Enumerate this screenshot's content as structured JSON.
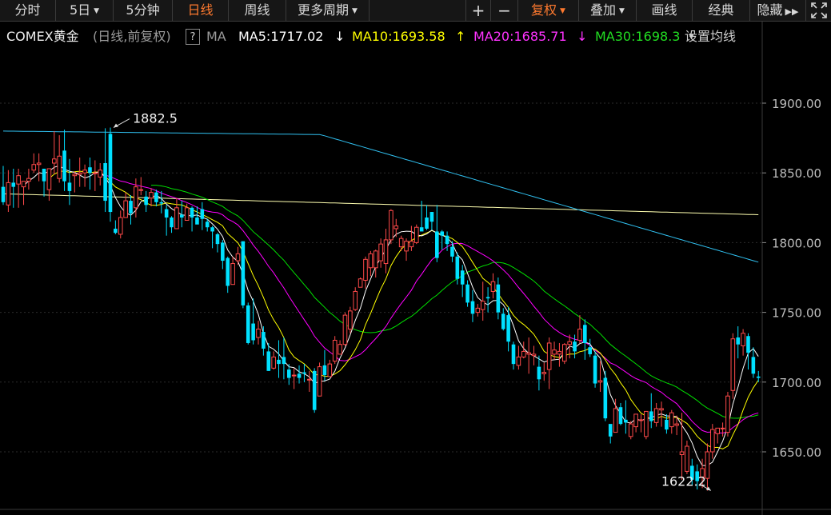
{
  "toolbar": {
    "tabs": [
      {
        "label": "分时",
        "active": false,
        "dropdown": false
      },
      {
        "label": "5日",
        "active": false,
        "dropdown": true
      },
      {
        "label": "5分钟",
        "active": false,
        "dropdown": false
      },
      {
        "label": "日线",
        "active": true,
        "dropdown": false
      },
      {
        "label": "周线",
        "active": false,
        "dropdown": false
      },
      {
        "label": "更多周期",
        "active": false,
        "dropdown": true
      }
    ],
    "tools": [
      {
        "label": "+",
        "active": false,
        "dropdown": false
      },
      {
        "label": "−",
        "active": false,
        "dropdown": false
      },
      {
        "label": "复权",
        "active": true,
        "dropdown": true
      },
      {
        "label": "叠加",
        "active": false,
        "dropdown": true
      },
      {
        "label": "画线",
        "active": false,
        "dropdown": false
      },
      {
        "label": "经典",
        "active": false,
        "dropdown": false
      },
      {
        "label": "隐藏",
        "active": false,
        "dropdown": false,
        "icon": "double-chevron-right-icon"
      }
    ],
    "fullscreen_icon": "fullscreen-icon"
  },
  "info": {
    "symbol": "COMEX黄金",
    "mode": "(日线,前复权)",
    "help": "?",
    "ma_label": "MA",
    "ma5": "MA5:1717.02",
    "ma5_arrow": "↓",
    "ma10": "MA10:1693.58",
    "ma10_arrow": "↑",
    "ma20": "MA20:1685.71",
    "ma20_arrow": "↓",
    "ma30": "MA30:1698.3",
    "ma_settings": "设置均线",
    "colors": {
      "ma5": "#ffffff",
      "ma10": "#ffff00",
      "ma20": "#ff00ff",
      "ma30": "#00e000"
    }
  },
  "chart_data": {
    "type": "candlestick",
    "yticks": [
      "1900.00",
      "1850.00",
      "1800.00",
      "1750.00",
      "1700.00",
      "1650.00"
    ],
    "ytick_values": [
      1900,
      1850,
      1800,
      1750,
      1700,
      1650
    ],
    "annotations": [
      {
        "text": "1882.5",
        "candle": 21,
        "value": 1882.5
      },
      {
        "text": "1622.2",
        "candle": 139,
        "value": 1622.2
      }
    ],
    "colors": {
      "up": "#ff4a4a",
      "down": "#00e0ff",
      "ma60": "#ffffb0",
      "ma120": "#30c0f0"
    },
    "candles": [
      [
        1840,
        1855,
        1829,
        1827
      ],
      [
        1827,
        1852,
        1843,
        1822
      ],
      [
        1843,
        1853,
        1840,
        1825
      ],
      [
        1842,
        1853,
        1848,
        1825
      ],
      [
        1840,
        1844,
        1844,
        1827
      ],
      [
        1844,
        1853,
        1846,
        1838
      ],
      [
        1852,
        1864,
        1856,
        1850
      ],
      [
        1856,
        1864,
        1857,
        1844
      ],
      [
        1853,
        1851,
        1844,
        1833
      ],
      [
        1838,
        1851,
        1853,
        1830
      ],
      [
        1857,
        1880,
        1860,
        1849
      ],
      [
        1846,
        1877,
        1862,
        1843
      ],
      [
        1866,
        1881,
        1844,
        1837
      ],
      [
        1843,
        1860,
        1837,
        1827
      ],
      [
        1848,
        1851,
        1849,
        1836
      ],
      [
        1849,
        1861,
        1850,
        1840
      ],
      [
        1850,
        1856,
        1852,
        1840
      ],
      [
        1854,
        1861,
        1850,
        1838
      ],
      [
        1850,
        1859,
        1850,
        1837
      ],
      [
        1847,
        1857,
        1852,
        1841
      ],
      [
        1857,
        1882,
        1830,
        1822
      ],
      [
        1878,
        1882.5,
        1822,
        1815
      ],
      [
        1810,
        1816,
        1807,
        1806
      ],
      [
        1806,
        1823,
        1818,
        1803
      ],
      [
        1818,
        1836,
        1830,
        1823
      ],
      [
        1830,
        1834,
        1821,
        1813
      ],
      [
        1825,
        1846,
        1840,
        1818
      ],
      [
        1838,
        1847,
        1838,
        1834
      ],
      [
        1833,
        1837,
        1827,
        1822
      ],
      [
        1832,
        1839,
        1836,
        1826
      ],
      [
        1836,
        1838,
        1829,
        1826
      ],
      [
        1829,
        1837,
        1828,
        1821
      ],
      [
        1824,
        1827,
        1818,
        1805
      ],
      [
        1818,
        1819,
        1811,
        1807
      ],
      [
        1810,
        1832,
        1825,
        1818
      ],
      [
        1820,
        1830,
        1818,
        1811
      ],
      [
        1816,
        1828,
        1825,
        1818
      ],
      [
        1825,
        1826,
        1818,
        1808
      ],
      [
        1818,
        1826,
        1813,
        1816
      ],
      [
        1824,
        1829,
        1817,
        1809
      ],
      [
        1815,
        1817,
        1811,
        1808
      ],
      [
        1811,
        1812,
        1808,
        1796
      ],
      [
        1806,
        1807,
        1799,
        1793
      ],
      [
        1800,
        1802,
        1787,
        1781
      ],
      [
        1789,
        1790,
        1769,
        1764
      ],
      [
        1770,
        1790,
        1785,
        1775
      ],
      [
        1787,
        1797,
        1792,
        1784
      ],
      [
        1801,
        1799,
        1755,
        1753
      ],
      [
        1755,
        1757,
        1728,
        1727
      ],
      [
        1742,
        1760,
        1730,
        1727
      ],
      [
        1732,
        1744,
        1738,
        1727
      ],
      [
        1736,
        1740,
        1724,
        1719
      ],
      [
        1722,
        1728,
        1708,
        1708
      ],
      [
        1710,
        1722,
        1718,
        1709
      ],
      [
        1716,
        1730,
        1713,
        1703
      ],
      [
        1718,
        1732,
        1713,
        1702
      ],
      [
        1709,
        1713,
        1703,
        1698
      ],
      [
        1705,
        1710,
        1705,
        1695
      ],
      [
        1706,
        1712,
        1703,
        1699
      ],
      [
        1707,
        1713,
        1706,
        1700
      ],
      [
        1702,
        1708,
        1702,
        1693
      ],
      [
        1708,
        1710,
        1680,
        1678
      ],
      [
        1690,
        1714,
        1711,
        1702
      ],
      [
        1712,
        1723,
        1705,
        1701
      ],
      [
        1704,
        1716,
        1713,
        1706
      ],
      [
        1715,
        1733,
        1730,
        1713
      ],
      [
        1720,
        1730,
        1727,
        1720
      ],
      [
        1727,
        1750,
        1748,
        1726
      ],
      [
        1738,
        1754,
        1751,
        1735
      ],
      [
        1752,
        1768,
        1765,
        1751
      ],
      [
        1768,
        1775,
        1774,
        1768
      ],
      [
        1773,
        1790,
        1788,
        1767
      ],
      [
        1782,
        1794,
        1792,
        1776
      ],
      [
        1782,
        1795,
        1794,
        1775
      ],
      [
        1787,
        1803,
        1799,
        1782
      ],
      [
        1785,
        1810,
        1802,
        1778
      ],
      [
        1802,
        1824,
        1823,
        1799
      ],
      [
        1810,
        1817,
        1812,
        1804
      ],
      [
        1797,
        1805,
        1803,
        1794
      ],
      [
        1794,
        1803,
        1801,
        1787
      ],
      [
        1797,
        1812,
        1801,
        1794
      ],
      [
        1800,
        1813,
        1811,
        1799
      ],
      [
        1811,
        1830,
        1808,
        1809
      ],
      [
        1818,
        1827,
        1810,
        1809
      ],
      [
        1822,
        1822,
        1815,
        1809
      ],
      [
        1808,
        1827,
        1789,
        1786
      ],
      [
        1808,
        1809,
        1805,
        1795
      ],
      [
        1805,
        1808,
        1799,
        1794
      ],
      [
        1797,
        1801,
        1790,
        1786
      ],
      [
        1790,
        1793,
        1774,
        1770
      ],
      [
        1780,
        1784,
        1770,
        1761
      ],
      [
        1770,
        1773,
        1757,
        1754
      ],
      [
        1758,
        1766,
        1749,
        1743
      ],
      [
        1750,
        1756,
        1753,
        1747
      ],
      [
        1752,
        1772,
        1758,
        1744
      ],
      [
        1761,
        1768,
        1760,
        1750
      ],
      [
        1765,
        1778,
        1772,
        1760
      ],
      [
        1770,
        1775,
        1750,
        1745
      ],
      [
        1749,
        1753,
        1738,
        1737
      ],
      [
        1748,
        1754,
        1729,
        1722
      ],
      [
        1727,
        1729,
        1713,
        1709
      ],
      [
        1712,
        1726,
        1718,
        1709
      ],
      [
        1718,
        1729,
        1722,
        1717
      ],
      [
        1720,
        1732,
        1721,
        1706
      ],
      [
        1719,
        1726,
        1720,
        1712
      ],
      [
        1711,
        1719,
        1702,
        1694
      ],
      [
        1706,
        1714,
        1707,
        1701
      ],
      [
        1709,
        1732,
        1728,
        1695
      ],
      [
        1720,
        1729,
        1723,
        1716
      ],
      [
        1720,
        1728,
        1722,
        1711
      ],
      [
        1715,
        1728,
        1727,
        1713
      ],
      [
        1727,
        1734,
        1729,
        1717
      ],
      [
        1729,
        1734,
        1722,
        1717
      ],
      [
        1730,
        1748,
        1738,
        1728
      ],
      [
        1741,
        1745,
        1728,
        1716
      ],
      [
        1725,
        1731,
        1720,
        1718
      ],
      [
        1719,
        1722,
        1699,
        1696
      ],
      [
        1700,
        1715,
        1701,
        1693
      ],
      [
        1703,
        1708,
        1674,
        1672
      ],
      [
        1670,
        1667,
        1661,
        1656
      ],
      [
        1664,
        1688,
        1681,
        1668
      ],
      [
        1682,
        1685,
        1670,
        1669
      ],
      [
        1673,
        1687,
        1671,
        1663
      ],
      [
        1661,
        1672,
        1670,
        1659
      ],
      [
        1668,
        1672,
        1677,
        1664
      ],
      [
        1673,
        1677,
        1673,
        1664
      ],
      [
        1661,
        1676,
        1679,
        1659
      ],
      [
        1679,
        1692,
        1672,
        1667
      ],
      [
        1671,
        1685,
        1681,
        1668
      ],
      [
        1680,
        1686,
        1681,
        1668
      ],
      [
        1673,
        1677,
        1666,
        1663
      ],
      [
        1668,
        1680,
        1678,
        1663
      ],
      [
        1669,
        1676,
        1670,
        1662
      ],
      [
        1648,
        1678,
        1650,
        1630
      ],
      [
        1636,
        1658,
        1654,
        1634
      ],
      [
        1640,
        1645,
        1630,
        1626
      ],
      [
        1636,
        1641,
        1629,
        1623
      ],
      [
        1632,
        1645,
        1638,
        1624
      ],
      [
        1631,
        1656,
        1650,
        1622.2
      ],
      [
        1650,
        1670,
        1666,
        1645
      ],
      [
        1663,
        1667,
        1667,
        1656
      ],
      [
        1667,
        1671,
        1667,
        1661
      ],
      [
        1664,
        1693,
        1690,
        1661
      ],
      [
        1694,
        1735,
        1731,
        1688
      ],
      [
        1732,
        1740,
        1727,
        1717
      ],
      [
        1726,
        1738,
        1735,
        1719
      ],
      [
        1733,
        1735,
        1721,
        1709
      ],
      [
        1718,
        1725,
        1706,
        1703
      ],
      [
        1704,
        1708,
        1703,
        1700
      ]
    ]
  }
}
